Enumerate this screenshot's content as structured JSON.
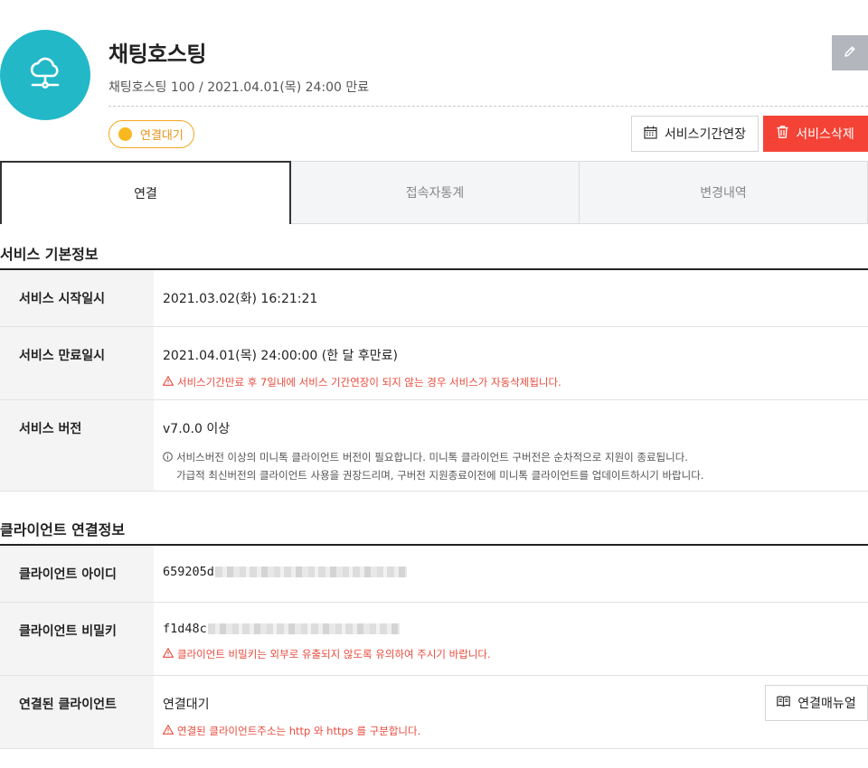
{
  "service": {
    "title": "채팅호스팅",
    "subtitle": "채팅호스팅 100 / 2021.04.01(목) 24:00 만료",
    "status": "연결대기",
    "icon": "cloud-network-icon",
    "avatar_color": "#22b8c8"
  },
  "actions": {
    "extend_label": "서비스기간연장",
    "delete_label": "서비스삭제"
  },
  "tabs": [
    {
      "label": "연결",
      "active": true
    },
    {
      "label": "접속자통계",
      "active": false
    },
    {
      "label": "변경내역",
      "active": false
    }
  ],
  "basic_info": {
    "title": "서비스 기본정보",
    "rows": [
      {
        "label": "서비스 시작일시",
        "value": "2021.03.02(화) 16:21:21"
      },
      {
        "label": "서비스 만료일시",
        "value": "2021.04.01(목) 24:00:00 (한 달 후만료)",
        "warning": "서비스기간만료 후 7일내에 서비스 기간연장이 되지 않는 경우 서비스가 자동삭제됩니다."
      },
      {
        "label": "서비스 버전",
        "value": "v7.0.0 이상",
        "info_line1": "서비스버전 이상의 미니톡 클라이언트 버전이 필요합니다. 미니톡 클라이언트 구버전은 순차적으로 지원이 종료됩니다.",
        "info_line2": "가급적 최신버전의 클라이언트 사용을 권장드리며, 구버전 지원종료이전에 미니톡 클라이언트를 업데이트하시기 바랍니다."
      }
    ]
  },
  "client_info": {
    "title": "클라이언트 연결정보",
    "rows": [
      {
        "label": "클라이언트 아이디",
        "value": "659205d"
      },
      {
        "label": "클라이언트 비밀키",
        "value": "f1d48c",
        "warning": "클라이언트 비밀키는 외부로 유출되지 않도록 유의하여 주시기 바랍니다."
      },
      {
        "label": "연결된 클라이언트",
        "value": "연결대기",
        "warning": "연결된 클라이언트주소는 http 와 https 를 구분합니다.",
        "button": "연결매뉴얼"
      }
    ]
  },
  "colors": {
    "accent": "#22b8c8",
    "danger": "#f44336",
    "warning_text": "#e84c3d",
    "status": "#f5a623"
  }
}
